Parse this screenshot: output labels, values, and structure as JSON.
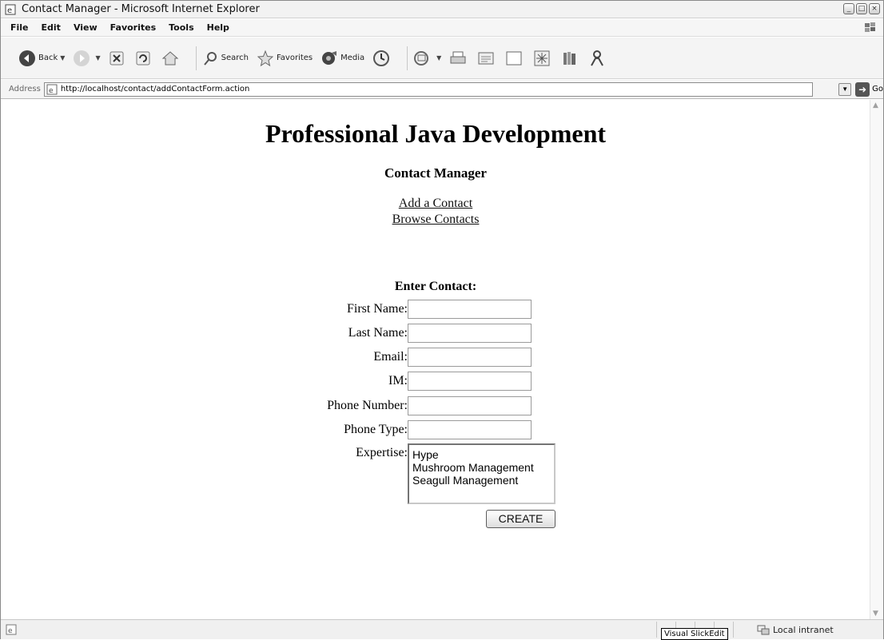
{
  "window": {
    "title": "Contact Manager - Microsoft Internet Explorer",
    "controls": [
      "_",
      "□",
      "×"
    ]
  },
  "menu": [
    "File",
    "Edit",
    "View",
    "Favorites",
    "Tools",
    "Help"
  ],
  "toolbar": {
    "back_label": "Back",
    "search_label": "Search",
    "favorites_label": "Favorites",
    "media_label": "Media"
  },
  "address": {
    "label": "Address",
    "url": "http://localhost/contact/addContactForm.action",
    "go_label": "Go"
  },
  "page": {
    "site_title": "Professional Java Development",
    "app_title": "Contact Manager",
    "nav": {
      "add_contact": "Add a Contact",
      "browse_contacts": "Browse Contacts"
    },
    "form": {
      "heading": "Enter Contact:",
      "first_name_label": "First Name:",
      "first_name_value": "",
      "last_name_label": "Last Name:",
      "last_name_value": "",
      "email_label": "Email:",
      "email_value": "",
      "im_label": "IM:",
      "im_value": "",
      "phone_number_label": "Phone Number:",
      "phone_number_value": "",
      "phone_type_label": "Phone Type:",
      "phone_type_value": "",
      "expertise_label": "Expertise:",
      "expertise_options": [
        "Hype",
        "Mushroom Management",
        "Seagull Management"
      ],
      "submit_label": "CREATE"
    }
  },
  "statusbar": {
    "tooltip": "Visual SlickEdit",
    "zone": "Local intranet"
  }
}
